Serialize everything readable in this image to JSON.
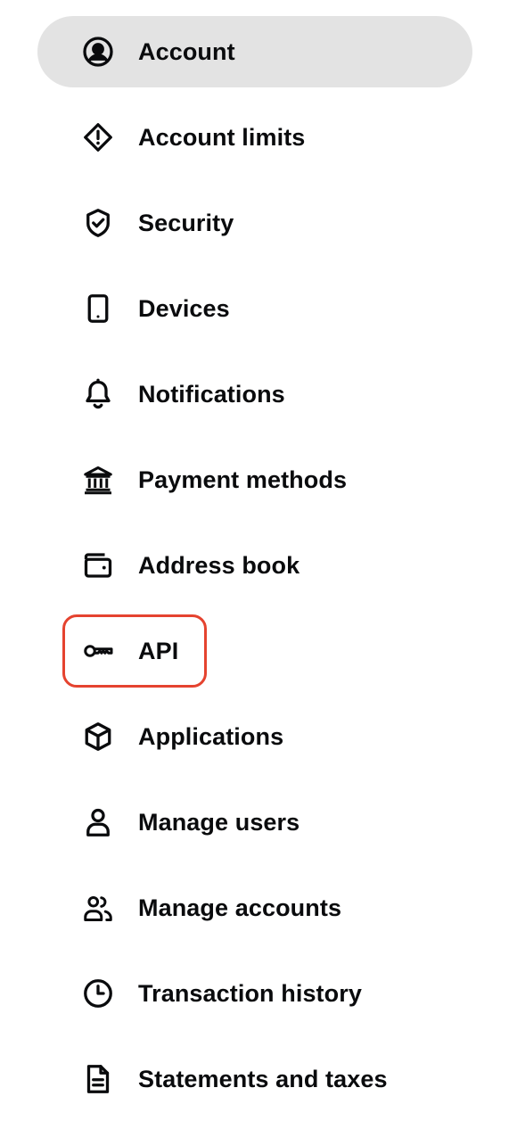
{
  "nav": {
    "items": [
      {
        "label": "Account",
        "icon": "account-circle-icon",
        "active": true
      },
      {
        "label": "Account limits",
        "icon": "alert-diamond-icon"
      },
      {
        "label": "Security",
        "icon": "shield-check-icon"
      },
      {
        "label": "Devices",
        "icon": "phone-icon"
      },
      {
        "label": "Notifications",
        "icon": "bell-icon"
      },
      {
        "label": "Payment methods",
        "icon": "bank-icon"
      },
      {
        "label": "Address book",
        "icon": "wallet-icon"
      },
      {
        "label": "API",
        "icon": "key-icon",
        "highlighted": true
      },
      {
        "label": "Applications",
        "icon": "box-icon"
      },
      {
        "label": "Manage users",
        "icon": "user-icon"
      },
      {
        "label": "Manage accounts",
        "icon": "users-icon"
      },
      {
        "label": "Transaction history",
        "icon": "clock-icon"
      },
      {
        "label": "Statements and taxes",
        "icon": "document-icon"
      }
    ]
  },
  "colors": {
    "active_bg": "#e3e3e3",
    "highlight_border": "#e5432f",
    "text": "#0a0b0d"
  }
}
